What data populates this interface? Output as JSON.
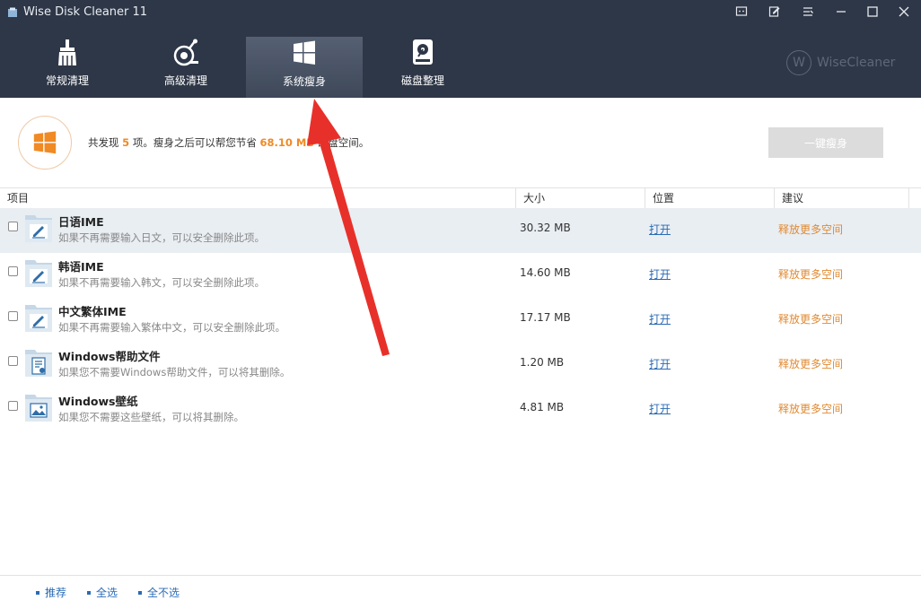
{
  "window": {
    "title": "Wise Disk Cleaner 11"
  },
  "nav": {
    "tabs": [
      {
        "label": "常规清理",
        "icon": "broom-icon"
      },
      {
        "label": "高级清理",
        "icon": "advanced-clean-icon"
      },
      {
        "label": "系统瘦身",
        "icon": "windows-icon",
        "active": true
      },
      {
        "label": "磁盘整理",
        "icon": "disk-defrag-icon"
      }
    ]
  },
  "brand": {
    "logo_letter": "W",
    "name": "WiseCleaner"
  },
  "summary": {
    "prefix": "共发现",
    "count": "5",
    "middle": "项。瘦身之后可以帮您节省",
    "size": "68.10 MB",
    "suffix": "磁盘空间。",
    "button_label": "一键瘦身"
  },
  "table": {
    "columns": [
      "项目",
      "大小",
      "位置",
      "建议"
    ],
    "rows": [
      {
        "name": "日语IME",
        "desc": "如果不再需要输入日文，可以安全删除此项。",
        "size": "30.32 MB",
        "open": "打开",
        "suggestion": "释放更多空间",
        "icon": "ime-icon"
      },
      {
        "name": "韩语IME",
        "desc": "如果不再需要输入韩文，可以安全删除此项。",
        "size": "14.60 MB",
        "open": "打开",
        "suggestion": "释放更多空间",
        "icon": "ime-icon"
      },
      {
        "name": "中文繁体IME",
        "desc": "如果不再需要输入繁体中文，可以安全删除此项。",
        "size": "17.17 MB",
        "open": "打开",
        "suggestion": "释放更多空间",
        "icon": "ime-icon"
      },
      {
        "name": "Windows帮助文件",
        "desc": "如果您不需要Windows帮助文件，可以将其删除。",
        "size": "1.20 MB",
        "open": "打开",
        "suggestion": "释放更多空间",
        "icon": "help-file-icon"
      },
      {
        "name": "Windows壁纸",
        "desc": "如果您不需要这些壁纸，可以将其删除。",
        "size": "4.81 MB",
        "open": "打开",
        "suggestion": "释放更多空间",
        "icon": "wallpaper-icon"
      }
    ]
  },
  "footer": {
    "links": [
      "推荐",
      "全选",
      "全不选"
    ]
  },
  "colors": {
    "header_bg": "#2e3747",
    "accent_orange": "#f08a24",
    "link_blue": "#2a6bb5",
    "annotation_arrow": "#e8302a"
  }
}
